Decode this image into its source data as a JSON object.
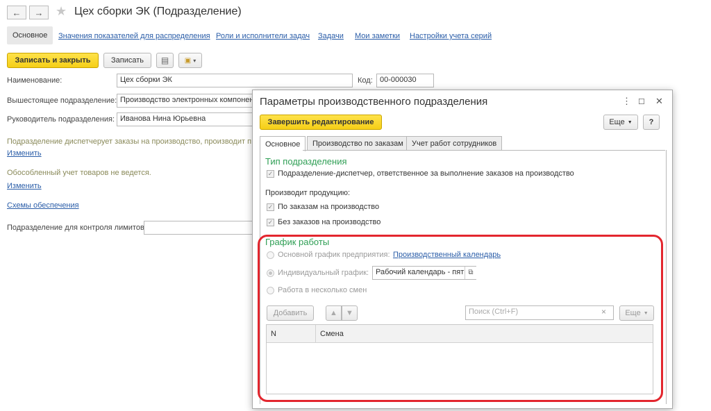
{
  "header": {
    "back_icon": "←",
    "forward_icon": "→",
    "star_icon": "★",
    "title": "Цех сборки ЭК (Подразделение)"
  },
  "tabs": {
    "active": "Основное",
    "links": [
      "Значения показателей для распределения",
      "Роли и исполнители задач",
      "Задачи",
      "Мои заметки",
      "Настройки учета серий"
    ]
  },
  "toolbar": {
    "save_close": "Записать и закрыть",
    "save": "Записать",
    "doc_icon": "▤",
    "print_icon": "▾"
  },
  "form": {
    "name_label": "Наименование:",
    "name_value": "Цех сборки ЭК",
    "code_label": "Код:",
    "code_value": "00-000030",
    "parent_label": "Вышестоящее подразделение:",
    "parent_value": "Производство электронных компонент",
    "head_label": "Руководитель подразделения:",
    "head_value": "Иванова Нина Юрьевна",
    "dispatch_note": "Подразделение диспетчерует заказы на производство, производит про",
    "change_link_1": "Изменить",
    "separate_note": "Обособленный учет товаров не ведется.",
    "change_link_2": "Изменить",
    "supply_link": "Схемы обеспечения",
    "limit_label": "Подразделение для контроля лимитов:",
    "limit_value": ""
  },
  "dialog": {
    "title": "Параметры производственного подразделения",
    "menu_icon": "⋮",
    "maximize_icon": "☐",
    "close_icon": "✕",
    "finish_button": "Завершить редактирование",
    "more_button": "Еще",
    "help_button": "?",
    "tabs": [
      "Основное",
      "Производство по заказам",
      "Учет работ сотрудников"
    ],
    "type_heading": "Тип подразделения",
    "dispatcher_checkbox": "Подразделение-диспетчер, ответственное за выполнение заказов на производство",
    "produces_label": "Производит продукцию:",
    "by_orders_checkbox": "По заказам на производство",
    "without_orders_checkbox": "Без заказов на производство",
    "schedule_heading": "График работы",
    "radio_main": "Основной график предприятия:",
    "calendar_link": "Производственный календарь",
    "radio_individual": "Индивидуальный график:",
    "individual_value": "Рабочий календарь - пяти",
    "radio_shifts": "Работа в несколько смен",
    "add_button": "Добавить",
    "up_icon": "🡅",
    "down_icon": "🡇",
    "search_placeholder": "Поиск (Ctrl+F)",
    "clear_icon": "×",
    "more_button_2": "Еще",
    "columns": [
      "N",
      "Смена"
    ]
  },
  "colors": {
    "accent_yellow": "#f5cf17",
    "link_blue": "#2a5da8",
    "heading_green": "#2e9e54",
    "highlight_red": "#e3262e"
  }
}
